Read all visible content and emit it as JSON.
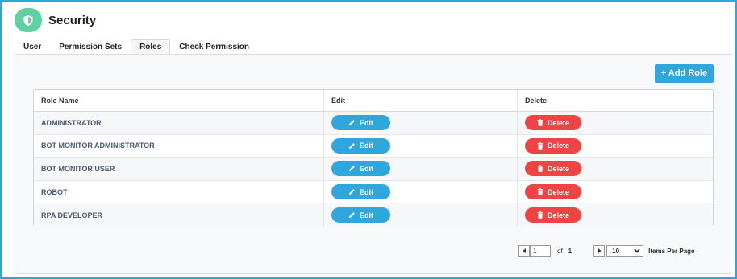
{
  "header": {
    "title": "Security",
    "icon": "shield-icon"
  },
  "tabs": [
    {
      "label": "User",
      "active": false
    },
    {
      "label": "Permission Sets",
      "active": false
    },
    {
      "label": "Roles",
      "active": true
    },
    {
      "label": "Check Permission",
      "active": false
    }
  ],
  "toolbar": {
    "add_role_label": "+ Add Role"
  },
  "table": {
    "headers": [
      "Role Name",
      "Edit",
      "Delete"
    ],
    "rows": [
      {
        "name": "ADMINISTRATOR",
        "edit": "Edit",
        "delete": "Delete"
      },
      {
        "name": "BOT MONITOR ADMINISTRATOR",
        "edit": "Edit",
        "delete": "Delete"
      },
      {
        "name": "BOT MONITOR USER",
        "edit": "Edit",
        "delete": "Delete"
      },
      {
        "name": "ROBOT",
        "edit": "Edit",
        "delete": "Delete"
      },
      {
        "name": "RPA DEVELOPER",
        "edit": "Edit",
        "delete": "Delete"
      }
    ]
  },
  "pager": {
    "page": "1",
    "of_label": "of",
    "total_pages": "1",
    "page_size": "10",
    "items_label": "Items Per Page"
  },
  "colors": {
    "accent": "#2fa6dc",
    "danger": "#ee4444",
    "logo": "#5fd1a0",
    "frame": "#29a8e0"
  }
}
